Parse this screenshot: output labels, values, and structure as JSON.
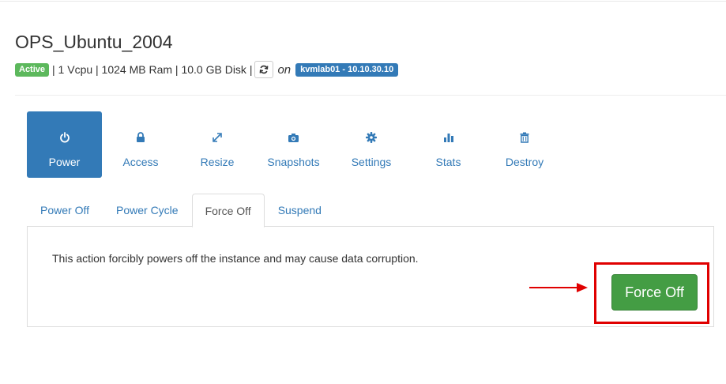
{
  "instance": {
    "name": "OPS_Ubuntu_2004",
    "status": "Active",
    "specs": "| 1 Vcpu | 1024 MB Ram | 10.0 GB Disk |",
    "on_label": "on",
    "host": "kvmlab01 - 10.10.30.10"
  },
  "nav": {
    "power": "Power",
    "access": "Access",
    "resize": "Resize",
    "snapshots": "Snapshots",
    "settings": "Settings",
    "stats": "Stats",
    "destroy": "Destroy"
  },
  "tabs": {
    "power_off": "Power Off",
    "power_cycle": "Power Cycle",
    "force_off": "Force Off",
    "suspend": "Suspend"
  },
  "panel": {
    "message": "This action forcibly powers off the instance and may cause data corruption.",
    "button_label": "Force Off"
  },
  "colors": {
    "primary": "#337ab7",
    "success": "#5cb85c",
    "button_green": "#449d44",
    "annotation_red": "#e00000"
  }
}
